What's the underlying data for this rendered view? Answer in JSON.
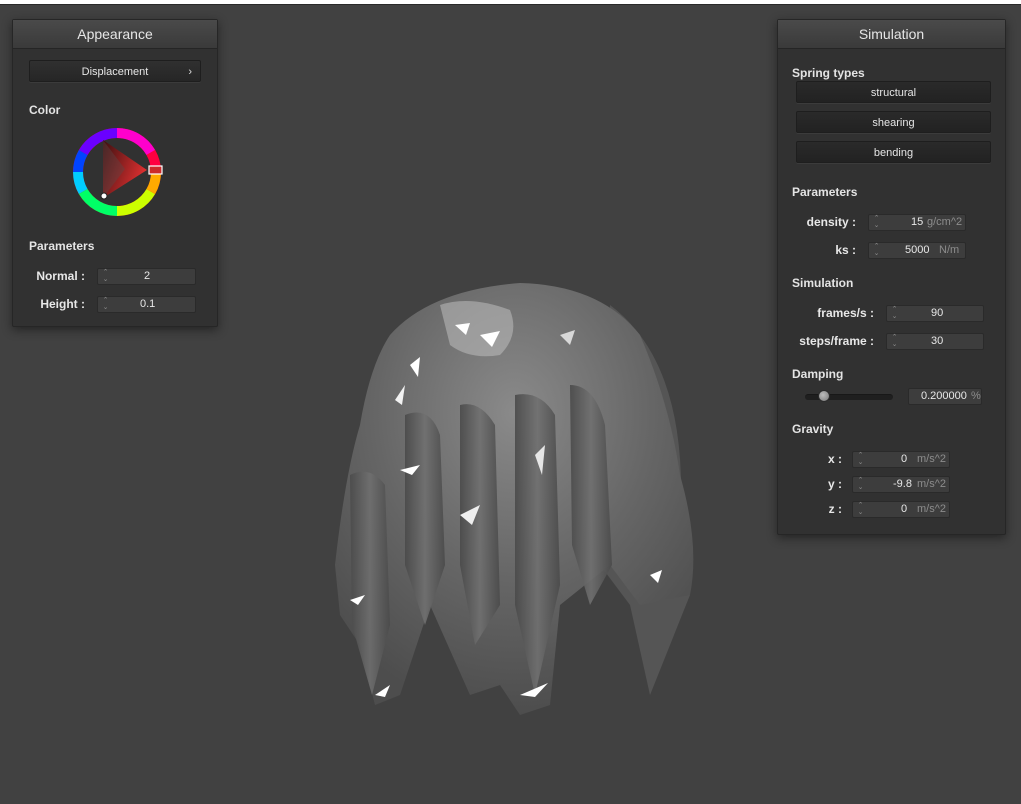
{
  "appearance": {
    "title": "Appearance",
    "shader_button": "Displacement",
    "color_label": "Color",
    "parameters_label": "Parameters",
    "normal_label": "Normal :",
    "normal_value": "2",
    "height_label": "Height :",
    "height_value": "0.1",
    "selected_color": "#cc2a2a"
  },
  "simulation": {
    "title": "Simulation",
    "spring_types_label": "Spring types",
    "spring_buttons": [
      "structural",
      "shearing",
      "bending"
    ],
    "parameters_label": "Parameters",
    "density_label": "density :",
    "density_value": "15",
    "density_unit": "g/cm^2",
    "ks_label": "ks :",
    "ks_value": "5000",
    "ks_unit": "N/m",
    "simulation_label": "Simulation",
    "fps_label": "frames/s :",
    "fps_value": "90",
    "steps_label": "steps/frame :",
    "steps_value": "30",
    "damping_label": "Damping",
    "damping_value": "0.200000",
    "damping_unit": "%",
    "damping_fraction": 0.2,
    "gravity_label": "Gravity",
    "gx_label": "x :",
    "gx_value": "0",
    "gy_label": "y :",
    "gy_value": "-9.8",
    "gz_label": "z :",
    "gz_value": "0",
    "gravity_unit": "m/s^2"
  }
}
